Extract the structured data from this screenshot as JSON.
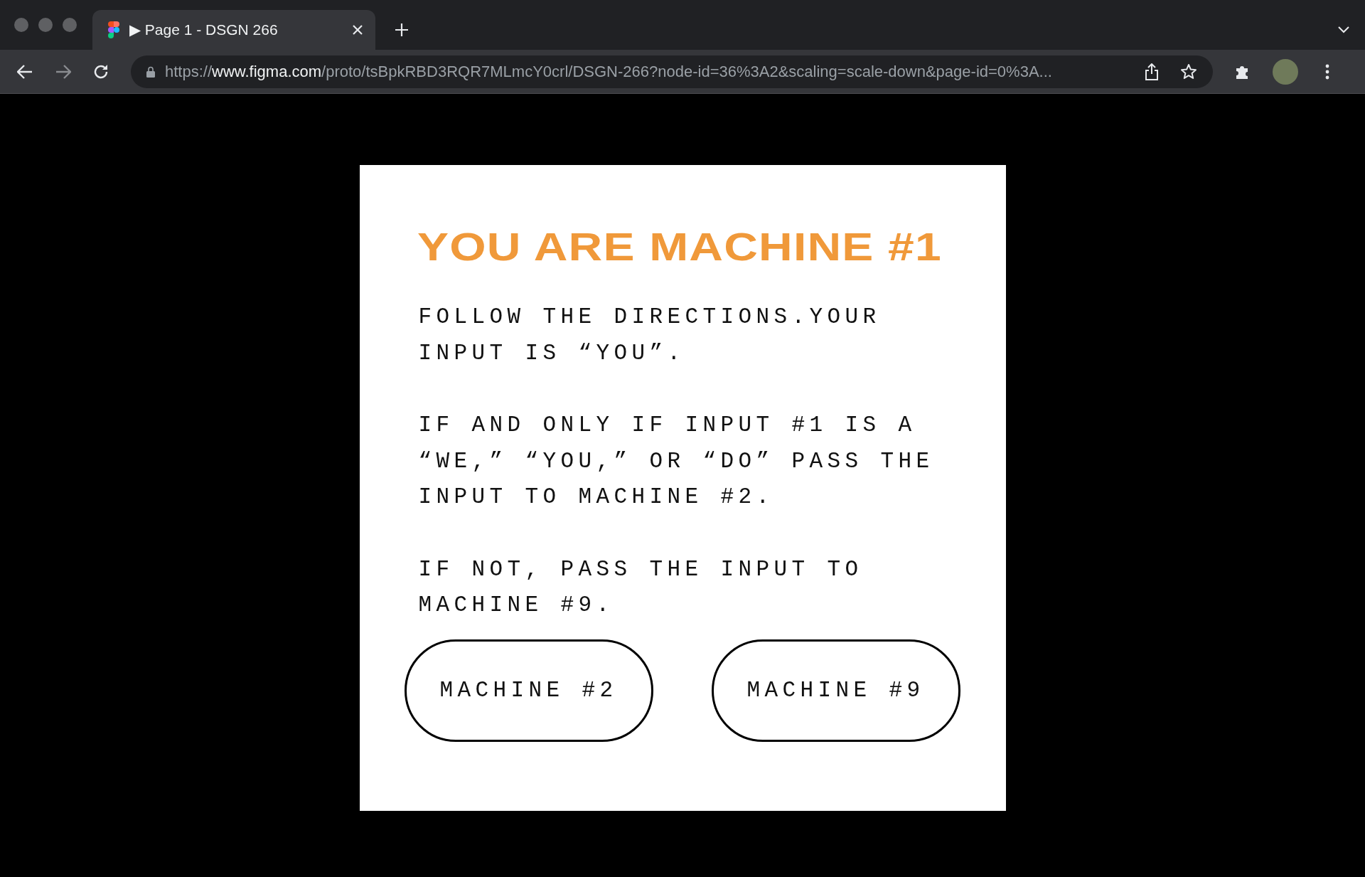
{
  "browser": {
    "tab": {
      "title": "▶ Page 1 - DSGN 266",
      "selected": true
    },
    "address_bar": {
      "segments": [
        {
          "text": "https://",
          "highlighted": false
        },
        {
          "text": "www.figma.com",
          "highlighted": true
        },
        {
          "text": "/proto/tsBpkRBD3RQR7MLmcY0crl/DSGN-266?node-id=36%3A2&scaling=scale-down&page-id=0%3A...",
          "highlighted": false
        }
      ]
    }
  },
  "card": {
    "heading": "YOU ARE MACHINE #1",
    "paragraphs": [
      "FOLLOW THE DIRECTIONS.YOUR INPUT IS “YOU”.",
      "IF AND ONLY IF INPUT #1 IS A “WE,” “YOU,” OR “DO” PASS THE INPUT TO MACHINE #2.",
      "IF NOT, PASS THE INPUT TO MACHINE #9."
    ],
    "buttons": [
      "MACHINE #2",
      "MACHINE #9"
    ]
  }
}
